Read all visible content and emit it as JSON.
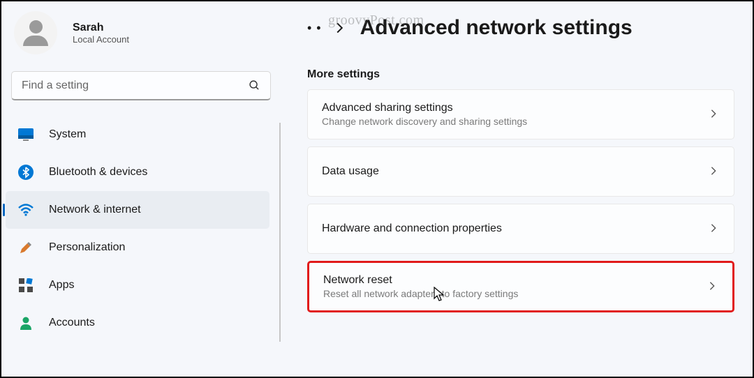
{
  "account": {
    "name": "Sarah",
    "type": "Local Account"
  },
  "search": {
    "placeholder": "Find a setting"
  },
  "sidebar": {
    "items": [
      {
        "label": "System"
      },
      {
        "label": "Bluetooth & devices"
      },
      {
        "label": "Network & internet"
      },
      {
        "label": "Personalization"
      },
      {
        "label": "Apps"
      },
      {
        "label": "Accounts"
      }
    ]
  },
  "breadcrumb": {
    "title": "Advanced network settings"
  },
  "watermark": "groovyPost.com",
  "section": {
    "title": "More settings"
  },
  "cards": [
    {
      "title": "Advanced sharing settings",
      "sub": "Change network discovery and sharing settings"
    },
    {
      "title": "Data usage",
      "sub": ""
    },
    {
      "title": "Hardware and connection properties",
      "sub": ""
    },
    {
      "title": "Network reset",
      "sub": "Reset all network adapters to factory settings"
    }
  ]
}
